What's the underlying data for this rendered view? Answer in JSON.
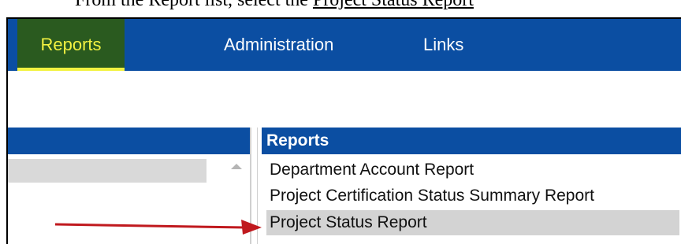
{
  "instruction": {
    "prefix": "From the Report list, select the ",
    "link": "Project Status Report"
  },
  "nav": {
    "items": [
      {
        "label": "Reports"
      },
      {
        "label": "Administration"
      },
      {
        "label": "Links"
      }
    ],
    "active": "Reports"
  },
  "reports_panel": {
    "title": "Reports",
    "items": [
      {
        "label": "Department Account Report"
      },
      {
        "label": "Project Certification Status Summary Report"
      },
      {
        "label": "Project Status Report"
      }
    ],
    "selected": "Project Status Report"
  },
  "colors": {
    "nav_bg": "#0b4ea2",
    "active_tab_bg": "#2a5a1f",
    "active_tab_text": "#f2f241",
    "selected_row_bg": "#d3d3d3",
    "arrow": "#c0191e"
  }
}
